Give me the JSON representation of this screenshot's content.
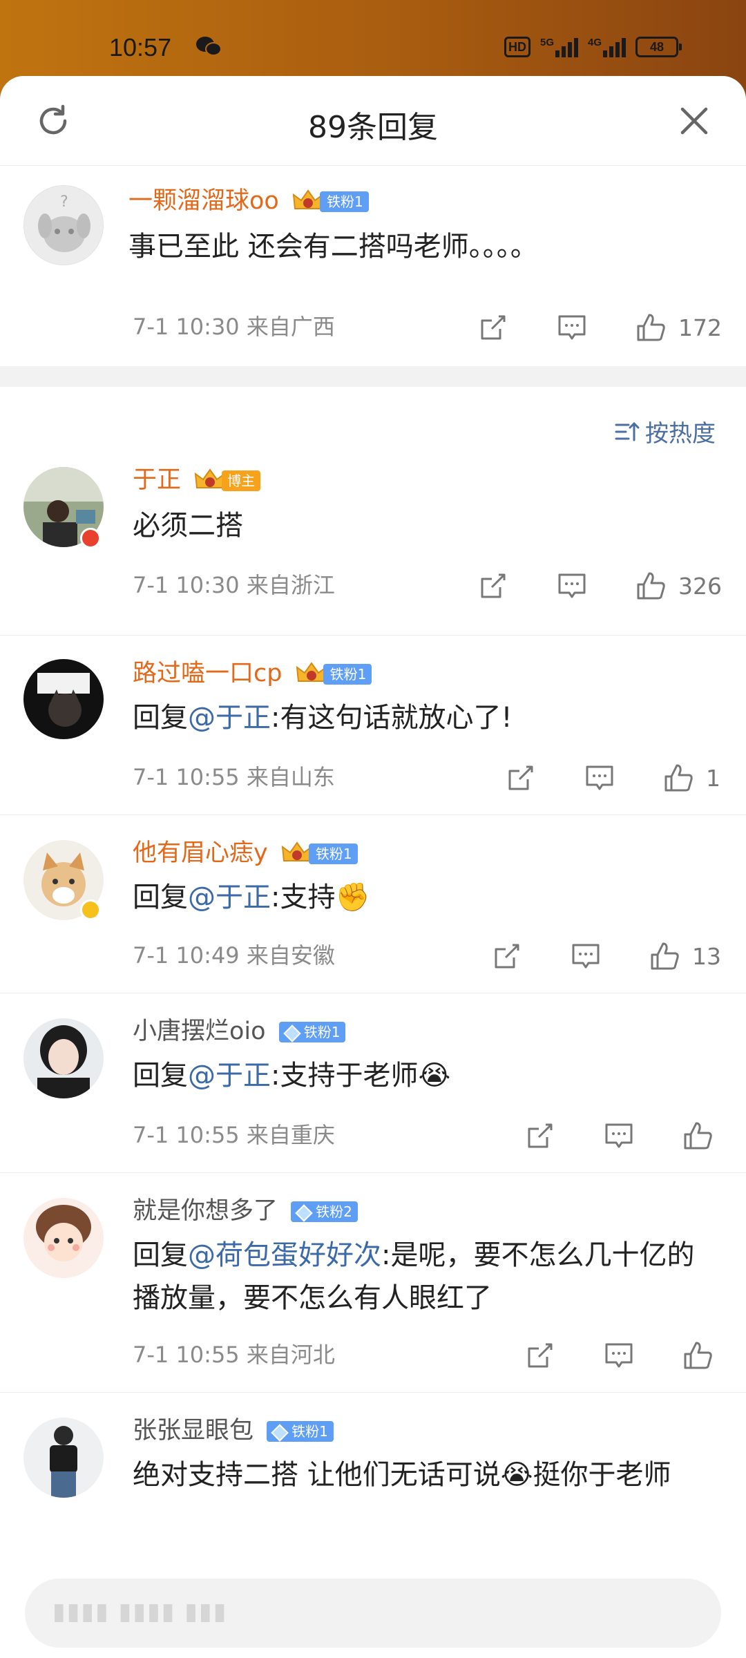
{
  "status": {
    "time": "10:57",
    "hd": "HD",
    "net1": "5G",
    "net2": "4G",
    "battery": "48"
  },
  "header": {
    "title": "89条回复"
  },
  "root": {
    "username": "一颗溜溜球oo",
    "badge": "铁粉1",
    "text": "事已至此 还会有二搭吗老师。。。。",
    "time": "7-1 10:30",
    "location": "来自广西",
    "likes": "172"
  },
  "sort": {
    "label": "按热度"
  },
  "replies": [
    {
      "username": "于正",
      "badge": "博主",
      "text": "必须二搭",
      "time": "7-1 10:30",
      "location": "来自浙江",
      "likes": "326"
    },
    {
      "username": "路过嗑一口cp",
      "badge": "铁粉1",
      "reply_prefix": "回复",
      "mention": "@于正",
      "text": ":有这句话就放心了!",
      "time": "7-1 10:55",
      "location": "来自山东",
      "likes": "1"
    },
    {
      "username": "他有眉心痣y",
      "badge": "铁粉1",
      "reply_prefix": "回复",
      "mention": "@于正",
      "text": ":支持✊",
      "time": "7-1 10:49",
      "location": "来自安徽",
      "likes": "13"
    },
    {
      "username": "小唐摆烂oio",
      "badge": "铁粉1",
      "reply_prefix": "回复",
      "mention": "@于正",
      "text": ":支持于老师😭",
      "time": "7-1 10:55",
      "location": "来自重庆",
      "likes": ""
    },
    {
      "username": "就是你想多了",
      "badge": "铁粉2",
      "reply_prefix": "回复",
      "mention": "@荷包蛋好好次",
      "text": ":是呢，要不怎么几十亿的播放量，要不怎么有人眼红了",
      "time": "7-1 10:55",
      "location": "来自河北",
      "likes": ""
    },
    {
      "username": "张张显眼包",
      "badge": "铁粉1",
      "text": "绝对支持二搭 让他们无话可说😭挺你于老师"
    }
  ],
  "colors": {
    "orange_name": "#e2691a",
    "mention_blue": "#3c6aa8",
    "fan_badge": "#5e9ff5",
    "host_badge": "#f6a21d"
  }
}
